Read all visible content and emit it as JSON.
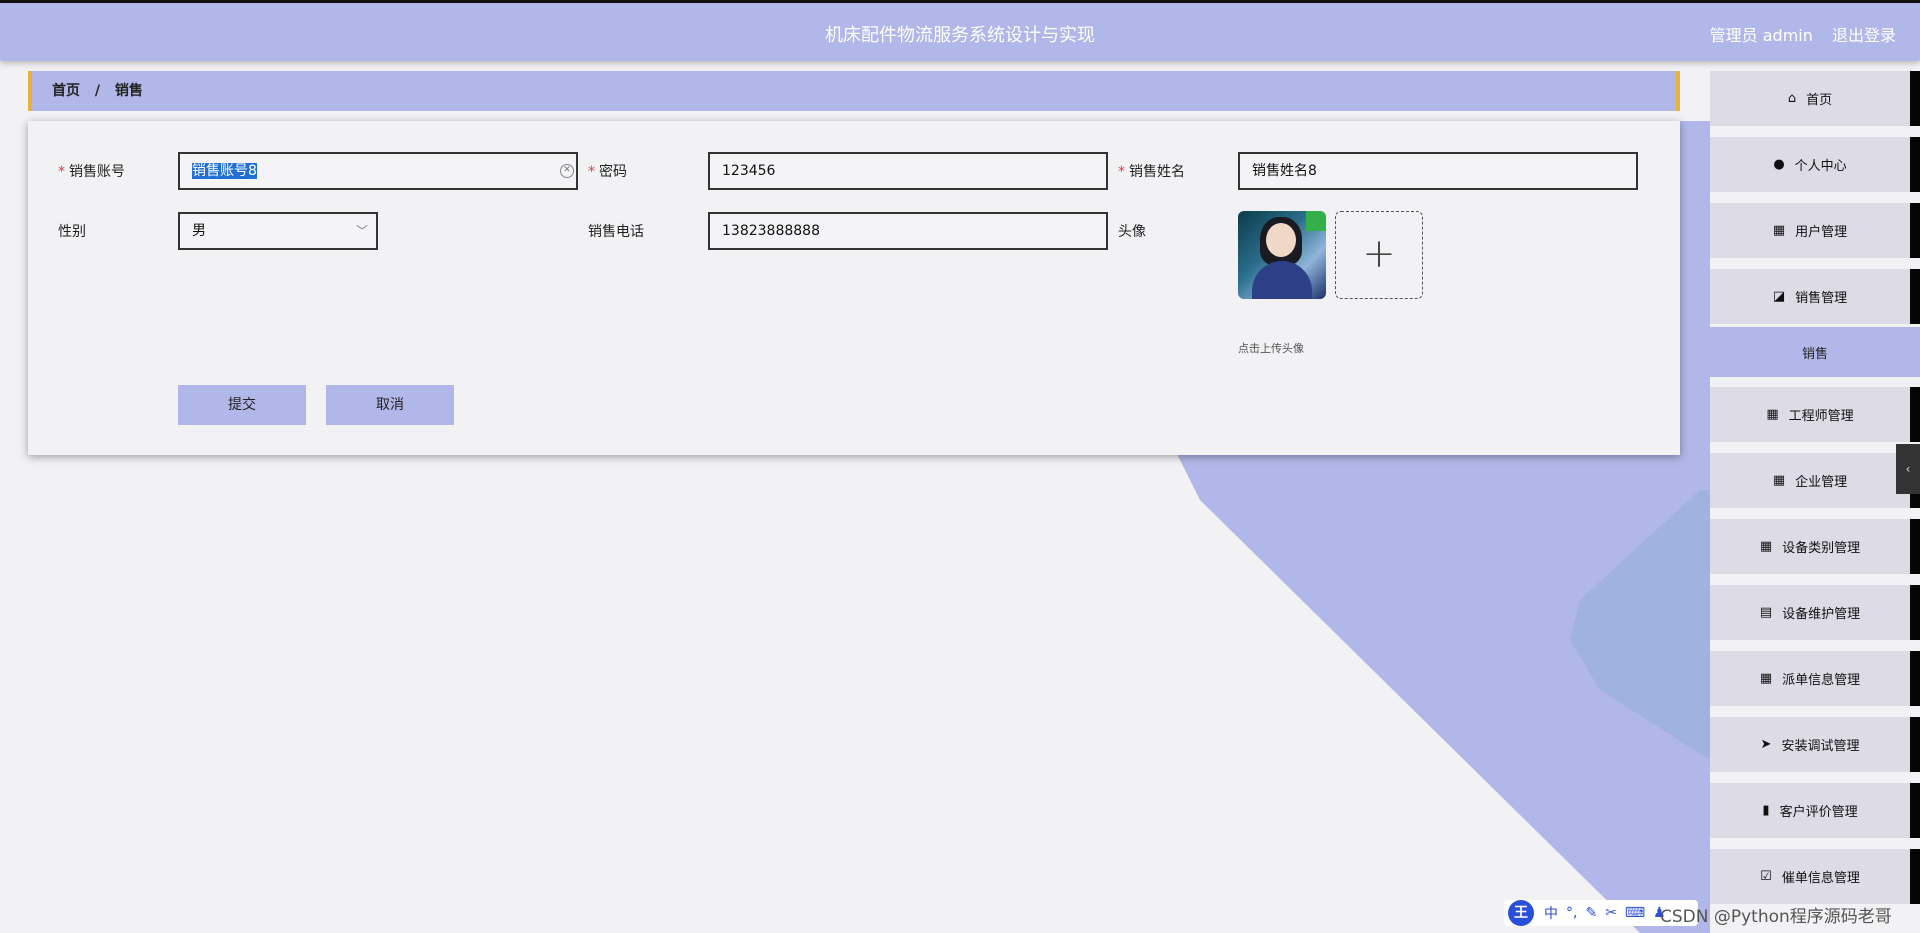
{
  "header": {
    "title": "机床配件物流服务系统设计与实现",
    "user_label": "管理员 admin",
    "logout_label": "退出登录"
  },
  "breadcrumb": {
    "home": "首页",
    "separator": "/",
    "current": "销售"
  },
  "form": {
    "account": {
      "label": "销售账号",
      "value": "销售账号8"
    },
    "password": {
      "label": "密码",
      "value": "123456"
    },
    "name": {
      "label": "销售姓名",
      "value": "销售姓名8"
    },
    "gender": {
      "label": "性别",
      "value": "男"
    },
    "phone": {
      "label": "销售电话",
      "value": "13823888888"
    },
    "avatar": {
      "label": "头像",
      "upload_hint": "点击上传头像",
      "plus": "+"
    },
    "required_mark": "*",
    "submit_label": "提交",
    "cancel_label": "取消"
  },
  "sidebar": {
    "items": [
      {
        "label": "首页",
        "icon": "home-icon"
      },
      {
        "label": "个人中心",
        "icon": "user-icon"
      },
      {
        "label": "用户管理",
        "icon": "grid-icon"
      },
      {
        "label": "销售管理",
        "icon": "chart-icon"
      },
      {
        "label": "工程师管理",
        "icon": "grid-icon"
      },
      {
        "label": "企业管理",
        "icon": "grid-icon"
      },
      {
        "label": "设备类别管理",
        "icon": "grid-icon"
      },
      {
        "label": "设备维护管理",
        "icon": "clipboard-icon"
      },
      {
        "label": "派单信息管理",
        "icon": "grid-icon"
      },
      {
        "label": "安装调试管理",
        "icon": "send-icon"
      },
      {
        "label": "客户评价管理",
        "icon": "bar-chart-icon"
      },
      {
        "label": "催单信息管理",
        "icon": "clipboard-check-icon"
      }
    ],
    "sub_item": "销售"
  },
  "ime": {
    "logo": "王",
    "mode": "中"
  },
  "watermark": "CSDN @Python程序源码老哥",
  "colors": {
    "accent": "#b1b7e8",
    "border_highlight": "#e8b33a",
    "required": "#e23b3b"
  }
}
